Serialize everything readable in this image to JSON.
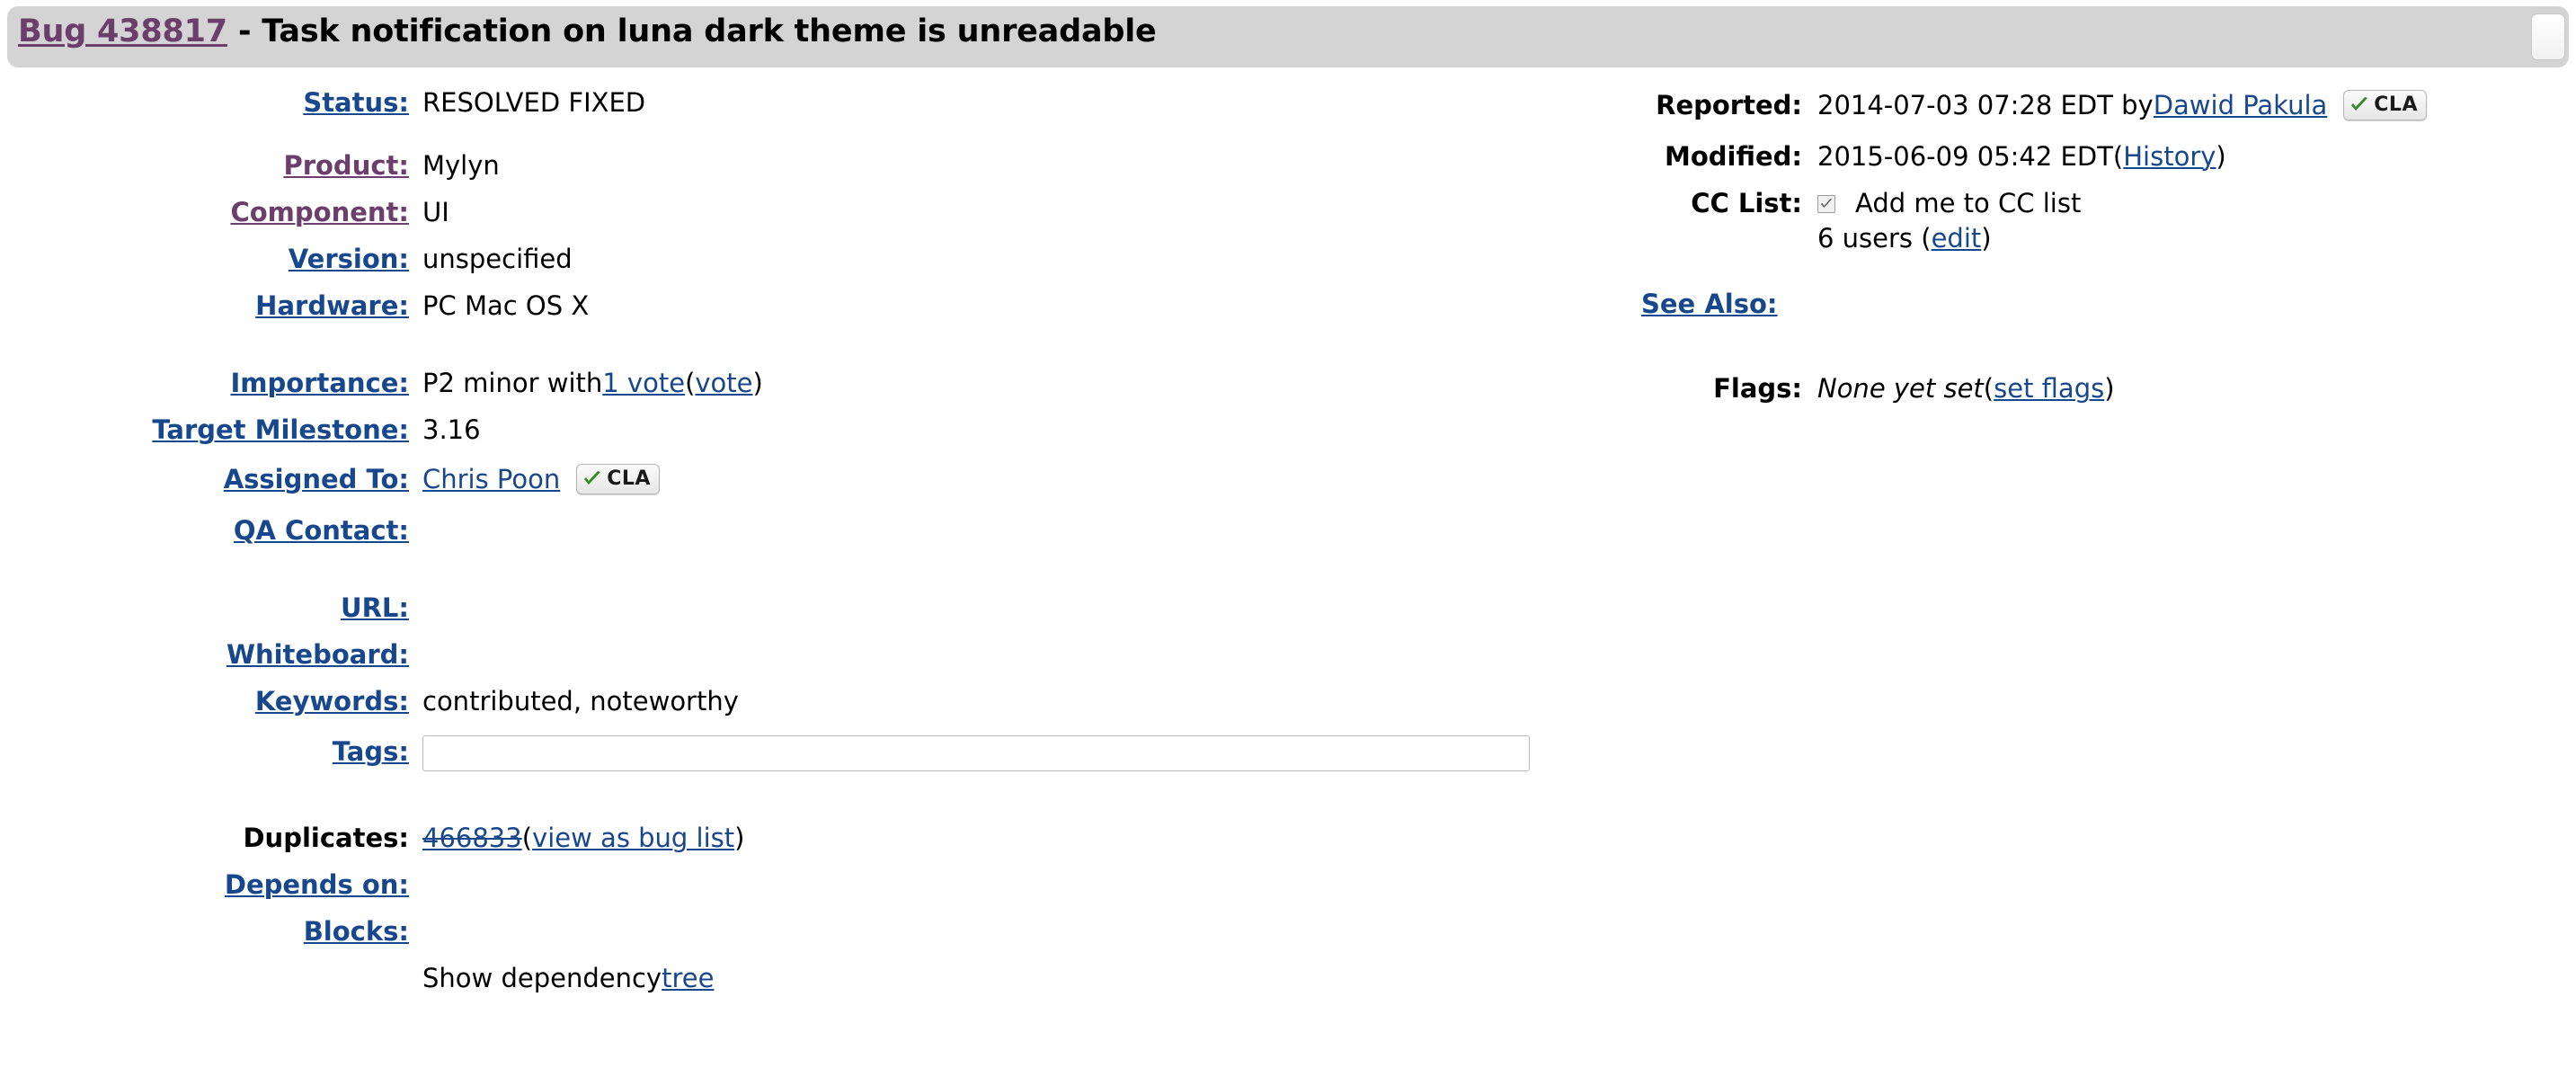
{
  "header": {
    "bug_link": "Bug 438817",
    "separator": " - ",
    "summary": "Task notification on luna dark theme is unreadable",
    "chrome_widget": "scroll-thumb"
  },
  "left_column": {
    "status": {
      "label": "Status:",
      "value": "RESOLVED FIXED"
    },
    "product": {
      "label": "Product:",
      "value": "Mylyn"
    },
    "component": {
      "label": "Component:",
      "value": "UI"
    },
    "version": {
      "label": "Version:",
      "value": "unspecified"
    },
    "hardware": {
      "label": "Hardware:",
      "value": "PC Mac OS X"
    },
    "importance": {
      "label": "Importance:",
      "value_prefix": "P2 minor with ",
      "vote_count_link": "1 vote",
      "open_paren": " (",
      "vote_link": "vote",
      "close_paren": ")"
    },
    "target_milestone": {
      "label": "Target Milestone:",
      "value": "3.16"
    },
    "assigned_to": {
      "label": "Assigned To:",
      "value_link": "Chris Poon",
      "cla_badge": "CLA"
    },
    "qa_contact": {
      "label": "QA Contact:",
      "value": ""
    },
    "url": {
      "label": "URL:",
      "value": ""
    },
    "whiteboard": {
      "label": "Whiteboard:",
      "value": ""
    },
    "keywords": {
      "label": "Keywords:",
      "value": "contributed, noteworthy"
    },
    "tags": {
      "label": "Tags:",
      "value": "",
      "placeholder": ""
    },
    "duplicates": {
      "label": "Duplicates:",
      "bug_link": "466833",
      "open_paren": " (",
      "view_link": "view as bug list",
      "close_paren": ")"
    },
    "depends_on": {
      "label": "Depends on:",
      "value": ""
    },
    "blocks": {
      "label": "Blocks:",
      "value": ""
    },
    "dependency_tree": {
      "text": "Show dependency ",
      "link": "tree"
    }
  },
  "right_column": {
    "reported": {
      "label": "Reported:",
      "value_prefix": "2014-07-03 07:28 EDT by ",
      "reporter_link": "Dawid Pakula",
      "cla_badge": "CLA"
    },
    "modified": {
      "label": "Modified:",
      "value_prefix": "2015-06-09 05:42 EDT ",
      "open_paren": "(",
      "history_link": "History",
      "close_paren": ")"
    },
    "cc_list": {
      "label": "CC List:",
      "checkbox_label": "Add me to CC list",
      "checkbox_checked": true,
      "users_text": "6 users ",
      "open_paren": "(",
      "edit_link": "edit",
      "close_paren": ")"
    },
    "see_also": {
      "label": "See Also:",
      "value": ""
    },
    "flags": {
      "label": "Flags:",
      "value_italic": "None yet set ",
      "open_paren": "(",
      "set_flags_link": "set flags",
      "close_paren": ")"
    }
  },
  "colors": {
    "link": "#17478c",
    "visited_link": "#6b3e6b",
    "header_bg": "#d4d4d4",
    "cla_check": "#2e8b1e",
    "page_bg": "#ffffff"
  }
}
